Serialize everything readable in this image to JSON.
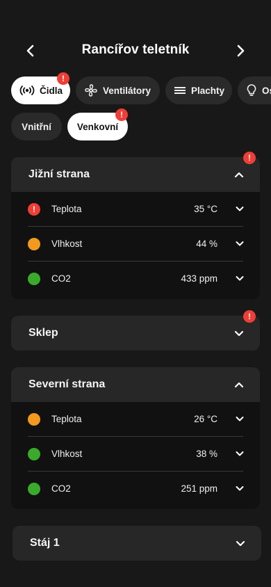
{
  "header": {
    "title": "Rancířov teletník"
  },
  "tabs": [
    {
      "label": "Čidla",
      "icon": "sensor-icon",
      "active": true,
      "alert": "!"
    },
    {
      "label": "Ventilátory",
      "icon": "fan-icon",
      "active": false
    },
    {
      "label": "Plachty",
      "icon": "menu-lines-icon",
      "active": false
    },
    {
      "label": "Os",
      "icon": "bulb-icon",
      "active": false
    }
  ],
  "location_chips": [
    {
      "label": "Vnitřní",
      "active": false
    },
    {
      "label": "Venkovní",
      "active": true,
      "alert": "!"
    }
  ],
  "sections": [
    {
      "title": "Jižní strana",
      "expanded": true,
      "alert": "!",
      "rows": [
        {
          "label": "Teplota",
          "value": "35 °C",
          "status": "alert",
          "status_color": "#ef3e36",
          "alert_mark": "!"
        },
        {
          "label": "Vlhkost",
          "value": "44 %",
          "status": "warning",
          "status_color": "#f29a1f"
        },
        {
          "label": "CO2",
          "value": "433 ppm",
          "status": "ok",
          "status_color": "#3aaa2c"
        }
      ]
    },
    {
      "title": "Sklep",
      "expanded": false,
      "alert": "!"
    },
    {
      "title": "Severní strana",
      "expanded": true,
      "rows": [
        {
          "label": "Teplota",
          "value": "26 °C",
          "status": "warning",
          "status_color": "#f29a1f"
        },
        {
          "label": "Vlhkost",
          "value": "38 %",
          "status": "ok",
          "status_color": "#3aaa2c"
        },
        {
          "label": "CO2",
          "value": "251 ppm",
          "status": "ok",
          "status_color": "#3aaa2c"
        }
      ]
    },
    {
      "title": "Stáj 1",
      "expanded": false
    }
  ],
  "colors": {
    "background": "#181818",
    "card": "#111111",
    "card_header": "#272727",
    "alert": "#ef3e36",
    "warning": "#f29a1f",
    "ok": "#3aaa2c"
  }
}
